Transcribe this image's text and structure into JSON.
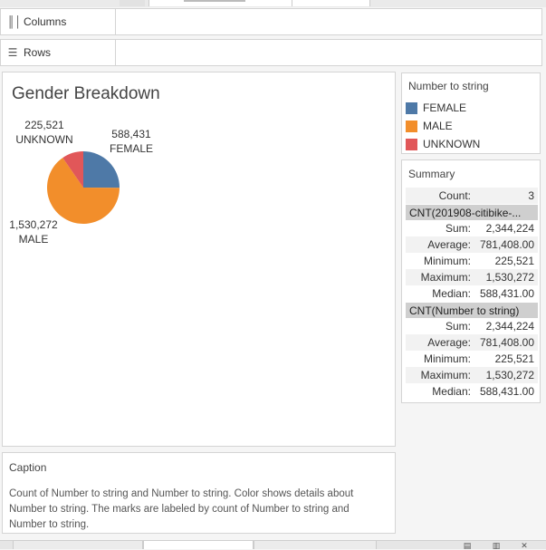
{
  "shelves": {
    "columns_label": "Columns",
    "rows_label": "Rows"
  },
  "worksheet": {
    "title": "Gender Breakdown"
  },
  "chart_data": {
    "type": "pie",
    "title": "Gender Breakdown",
    "slices": [
      {
        "label": "FEMALE",
        "value": 588431,
        "value_label": "588,431",
        "color": "#4e79a7"
      },
      {
        "label": "MALE",
        "value": 1530272,
        "value_label": "1,530,272",
        "color": "#f28e2b"
      },
      {
        "label": "UNKNOWN",
        "value": 225521,
        "value_label": "225,521",
        "color": "#e15759"
      }
    ]
  },
  "legend": {
    "title": "Number to string",
    "items": [
      {
        "label": "FEMALE",
        "color": "#4e79a7"
      },
      {
        "label": "MALE",
        "color": "#f28e2b"
      },
      {
        "label": "UNKNOWN",
        "color": "#e15759"
      }
    ]
  },
  "summary": {
    "title": "Summary",
    "count_label": "Count:",
    "count_value": "3",
    "groups": [
      {
        "name": "CNT(201908-citibike-...",
        "stats": [
          {
            "k": "Sum:",
            "v": "2,344,224"
          },
          {
            "k": "Average:",
            "v": "781,408.00"
          },
          {
            "k": "Minimum:",
            "v": "225,521"
          },
          {
            "k": "Maximum:",
            "v": "1,530,272"
          },
          {
            "k": "Median:",
            "v": "588,431.00"
          }
        ]
      },
      {
        "name": "CNT(Number to string)",
        "stats": [
          {
            "k": "Sum:",
            "v": "2,344,224"
          },
          {
            "k": "Average:",
            "v": "781,408.00"
          },
          {
            "k": "Minimum:",
            "v": "225,521"
          },
          {
            "k": "Maximum:",
            "v": "1,530,272"
          },
          {
            "k": "Median:",
            "v": "588,431.00"
          }
        ]
      }
    ]
  },
  "caption": {
    "title": "Caption",
    "text": "Count of Number to string and Number to string.  Color shows details about Number to string.  The marks are labeled by count of Number to string and Number to string."
  }
}
